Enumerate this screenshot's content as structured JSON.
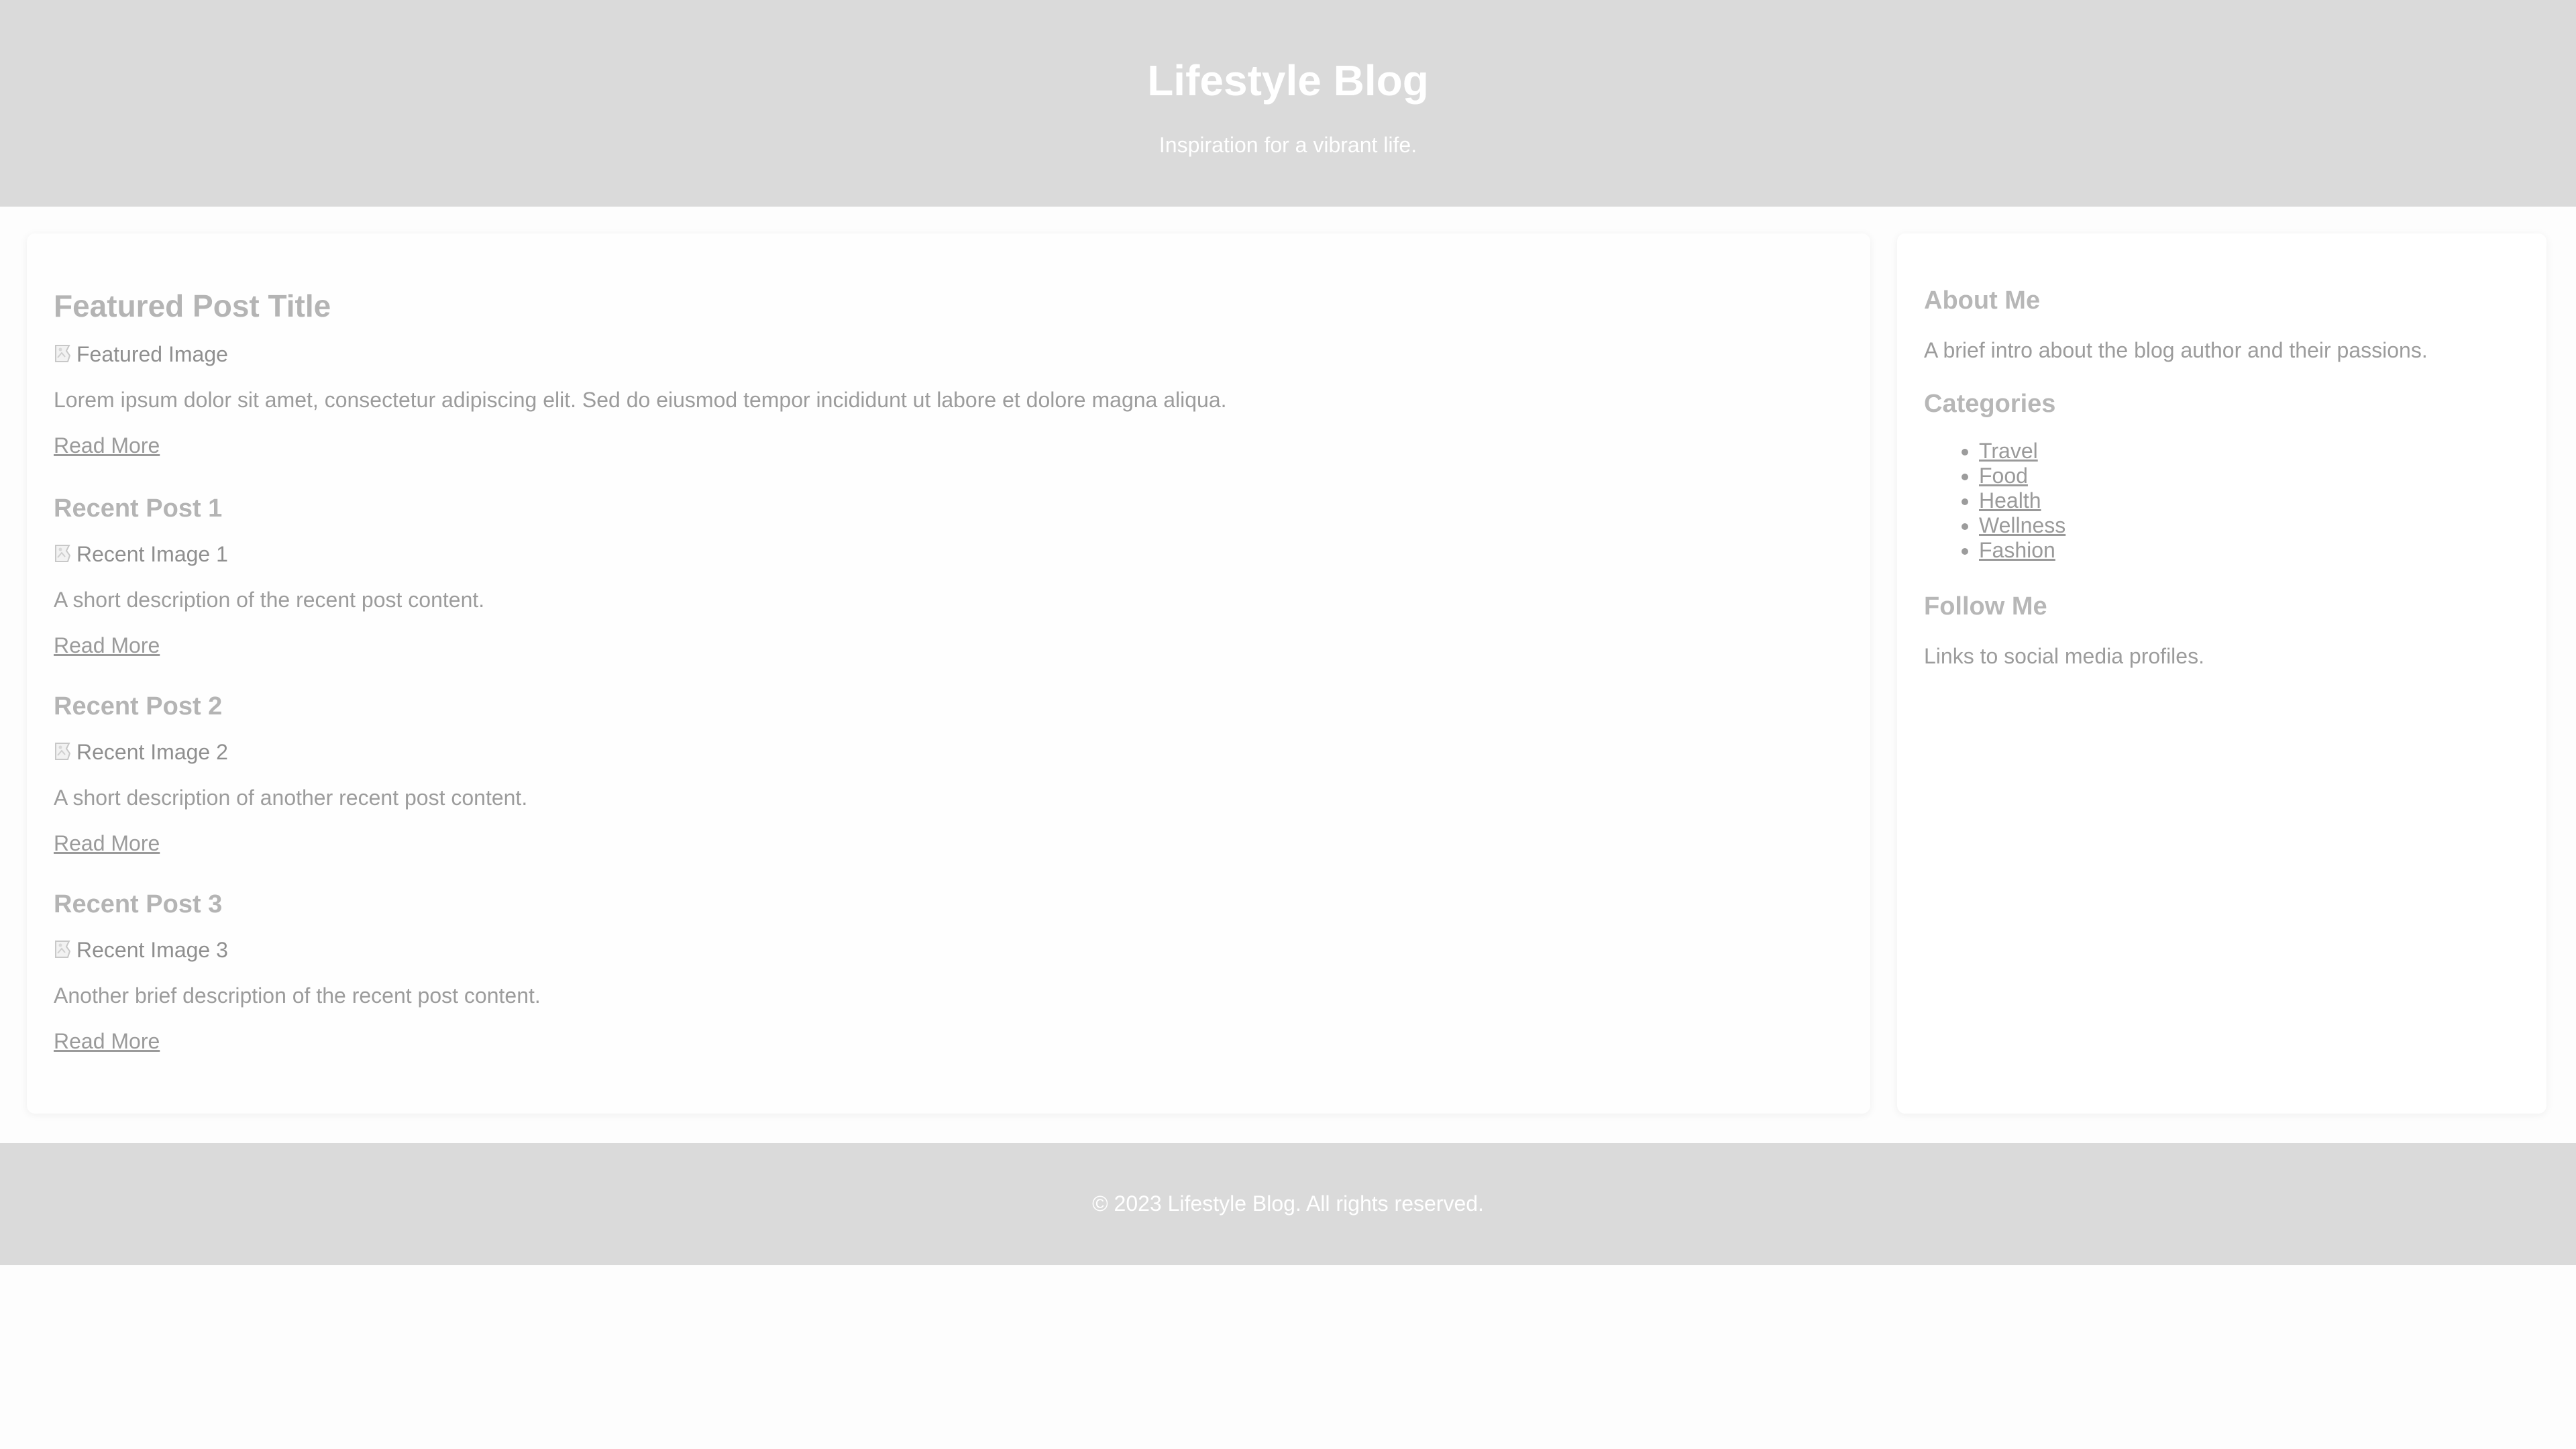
{
  "header": {
    "title": "Lifestyle Blog",
    "tagline": "Inspiration for a vibrant life."
  },
  "main": {
    "featured": {
      "title": "Featured Post Title",
      "image_alt": "Featured Image",
      "excerpt": "Lorem ipsum dolor sit amet, consectetur adipiscing elit. Sed do eiusmod tempor incididunt ut labore et dolore magna aliqua.",
      "read_more": "Read More"
    },
    "recent": [
      {
        "title": "Recent Post 1",
        "image_alt": "Recent Image 1",
        "excerpt": "A short description of the recent post content.",
        "read_more": "Read More"
      },
      {
        "title": "Recent Post 2",
        "image_alt": "Recent Image 2",
        "excerpt": "A short description of another recent post content.",
        "read_more": "Read More"
      },
      {
        "title": "Recent Post 3",
        "image_alt": "Recent Image 3",
        "excerpt": "Another brief description of the recent post content.",
        "read_more": "Read More"
      }
    ]
  },
  "sidebar": {
    "about": {
      "heading": "About Me",
      "text": "A brief intro about the blog author and their passions."
    },
    "categories": {
      "heading": "Categories",
      "items": [
        "Travel",
        "Food",
        "Health",
        "Wellness",
        "Fashion"
      ]
    },
    "follow": {
      "heading": "Follow Me",
      "text": "Links to social media profiles."
    }
  },
  "footer": {
    "text": "© 2023 Lifestyle Blog. All rights reserved."
  },
  "icons": {
    "broken_image": "broken-image-icon"
  },
  "colors": {
    "header_bg": "#dadada",
    "footer_bg": "#dadada",
    "page_bg": "#fdfdfd",
    "text": "#9a9a9a",
    "heading": "#b4b4b4",
    "inverse_text": "#ffffff"
  }
}
